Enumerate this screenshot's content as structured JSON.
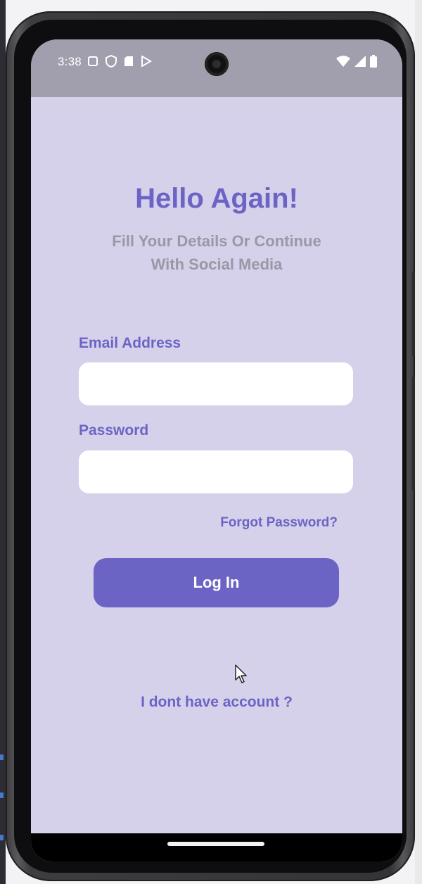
{
  "status_bar": {
    "time": "3:38",
    "left_icons": [
      "screen-icon",
      "shield-icon",
      "sd-card-icon",
      "play-store-icon"
    ],
    "right_icons": [
      "wifi-icon",
      "cell-signal-icon",
      "battery-icon"
    ]
  },
  "login": {
    "title": "Hello Again!",
    "subtitle_line1": "Fill Your Details Or Continue",
    "subtitle_line2": "With Social Media",
    "email_label": "Email Address",
    "email_value": "",
    "password_label": "Password",
    "password_value": "",
    "forgot_label": "Forgot Password?",
    "login_button_label": "Log In",
    "no_account_label": "I dont have account ?"
  },
  "colors": {
    "accent": "#6c64c4",
    "background": "#d5d1eb",
    "status_bar": "#a19fad",
    "subtitle": "#9a98a5",
    "input_background": "#ffffff"
  }
}
